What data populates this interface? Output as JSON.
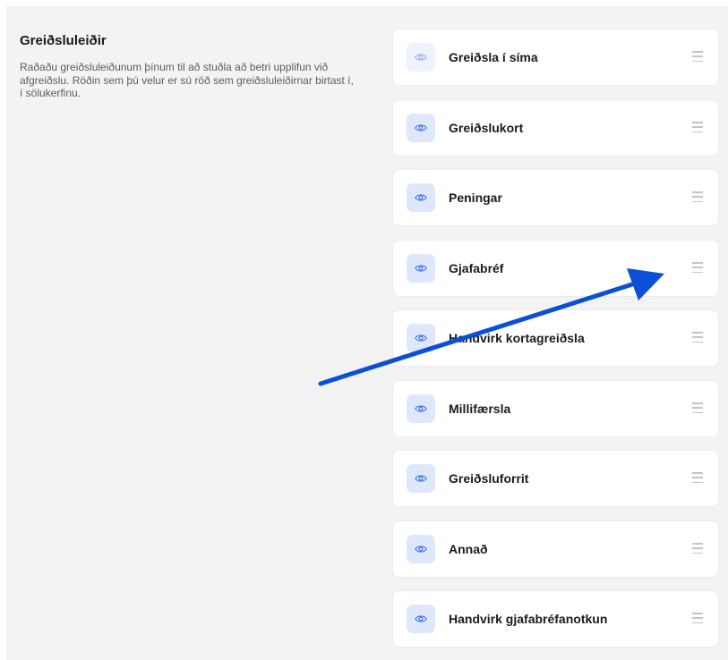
{
  "section": {
    "title": "Greiðsluleiðir",
    "description": "Raðaðu greiðsluleiðunum þínum til að stuðla að betri upplifun við afgreiðslu. Röðin sem þú velur er sú röð sem greiðsluleiðirnar birtast í, í sölukerfinu."
  },
  "payment_methods": [
    {
      "label": "Greiðsla í síma",
      "visible": false
    },
    {
      "label": "Greiðslukort",
      "visible": true
    },
    {
      "label": "Peningar",
      "visible": true
    },
    {
      "label": "Gjafabréf",
      "visible": true
    },
    {
      "label": "Handvirk kortagreiðsla",
      "visible": true
    },
    {
      "label": "Millifærsla",
      "visible": true
    },
    {
      "label": "Greiðsluforrit",
      "visible": true
    },
    {
      "label": "Annað",
      "visible": true
    },
    {
      "label": "Handvirk gjafabréfanotkun",
      "visible": true
    }
  ],
  "icons": {
    "visibility": "eye-icon",
    "reorder": "drag-handle-icon"
  },
  "colors": {
    "accent": "#3f78ee",
    "arrow": "#0b4fd6"
  }
}
